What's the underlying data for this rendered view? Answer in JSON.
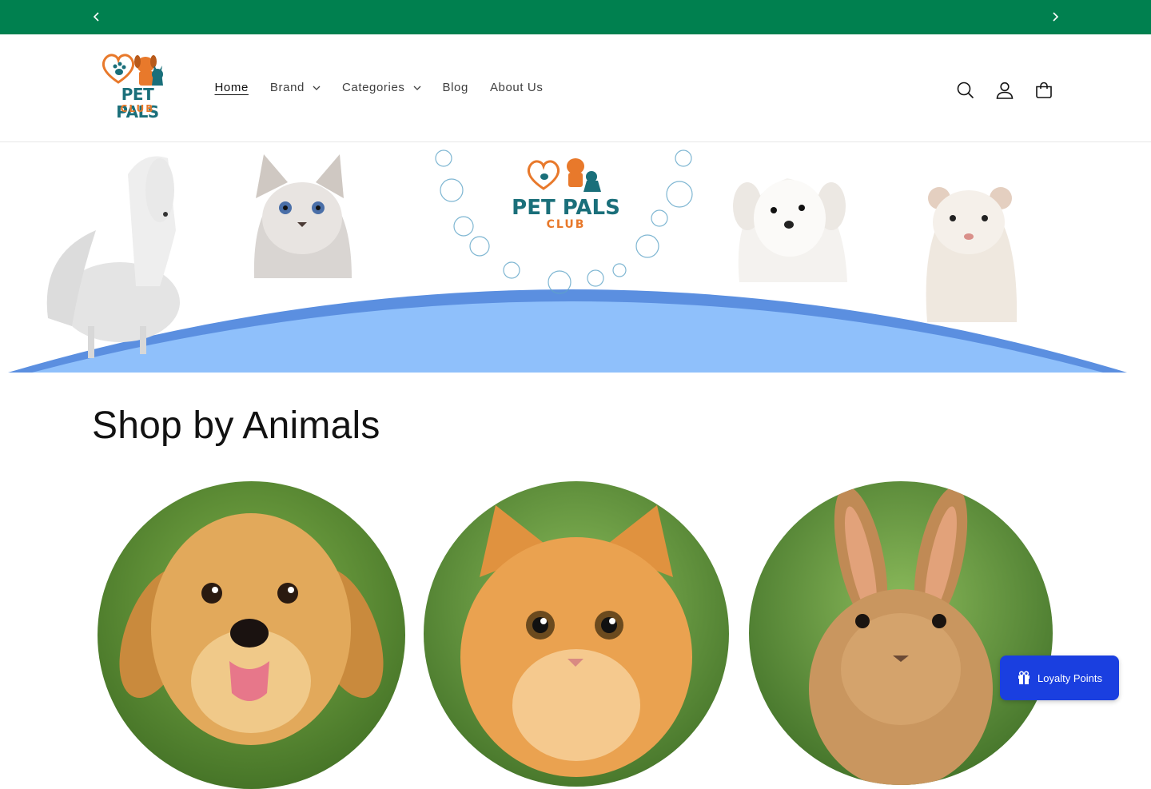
{
  "announcement": {
    "prev_icon": "chevron-left-icon",
    "next_icon": "chevron-right-icon",
    "background": "#00804f"
  },
  "header": {
    "logo": {
      "line1": "PET PALS",
      "line2": "CLUB"
    },
    "nav": [
      {
        "label": "Home",
        "active": true,
        "has_dropdown": false
      },
      {
        "label": "Brand",
        "active": false,
        "has_dropdown": true
      },
      {
        "label": "Categories",
        "active": false,
        "has_dropdown": true
      },
      {
        "label": "Blog",
        "active": false,
        "has_dropdown": false
      },
      {
        "label": "About Us",
        "active": false,
        "has_dropdown": false
      }
    ],
    "icons": [
      "search-icon",
      "account-icon",
      "cart-icon"
    ]
  },
  "hero": {
    "logo": {
      "line1": "PET PALS",
      "line2": "CLUB"
    },
    "animals": [
      "horse",
      "cat",
      "dog",
      "ferret"
    ]
  },
  "shop_by_animals": {
    "title": "Shop by Animals",
    "tiles": [
      "dog",
      "cat",
      "rabbit"
    ]
  },
  "loyalty": {
    "label": "Loyalty Points",
    "icon": "gift-icon",
    "color": "#1a3fe0"
  }
}
